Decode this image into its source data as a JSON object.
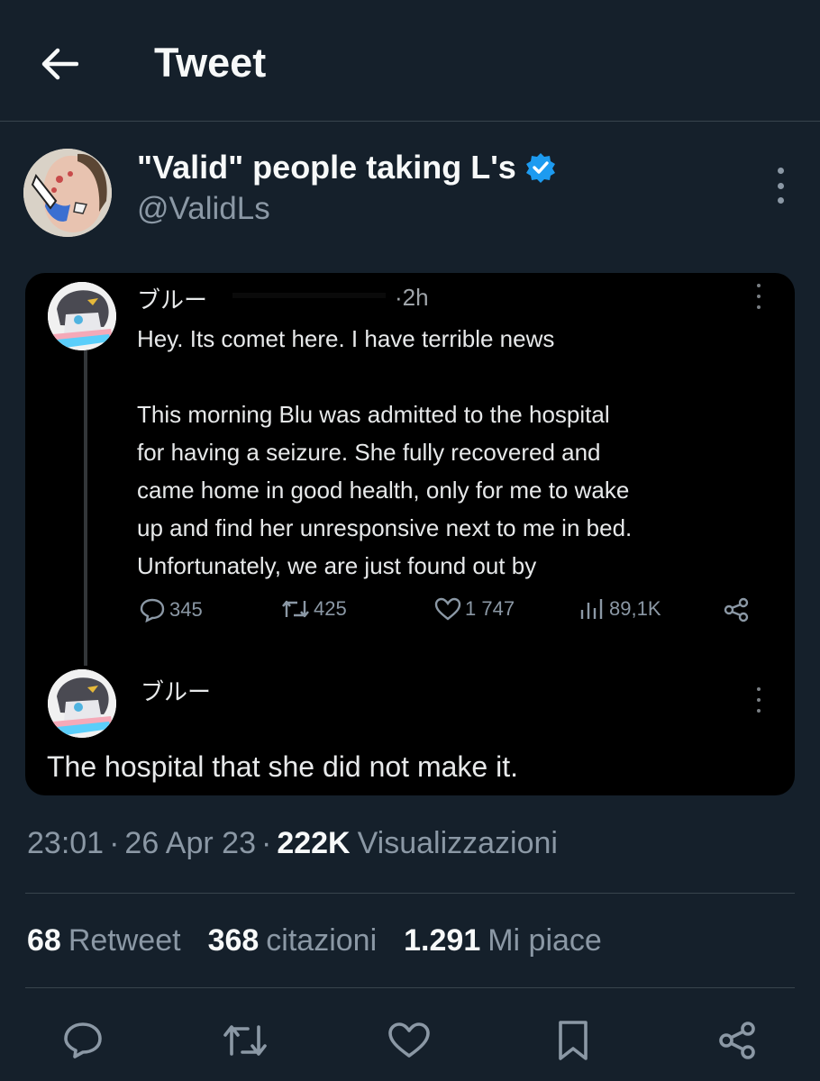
{
  "header": {
    "title": "Tweet"
  },
  "author": {
    "name": "\"Valid\" people taking L's",
    "handle": "@ValidLs"
  },
  "embedded": {
    "post1": {
      "name": "ブルー",
      "time": "·2h",
      "text": "Hey. Its comet here. I have terrible news\n\nThis morning Blu was admitted to the hospital\nfor having a seizure. She fully recovered and\ncame home in good health, only for me to wake\nup and find her unresponsive next to me in bed.\nUnfortunately, we are just found out by",
      "replies": "345",
      "retweets": "425",
      "likes": "1 747",
      "views": "89,1K"
    },
    "post2": {
      "name": "ブルー",
      "text": "The hospital that she did not make it."
    }
  },
  "meta": {
    "time": "23:01",
    "date": "26 Apr 23",
    "views": "222K",
    "views_label": "Visualizzazioni",
    "sep": "·"
  },
  "stats": {
    "retweets": "68",
    "retweets_label": "Retweet",
    "quotes": "368",
    "quotes_label": "citazioni",
    "likes": "1.291",
    "likes_label": "Mi piace"
  },
  "colors": {
    "bg": "#15202b",
    "accent": "#1d9bf0",
    "muted": "#8b98a5",
    "divider": "#38444d"
  }
}
